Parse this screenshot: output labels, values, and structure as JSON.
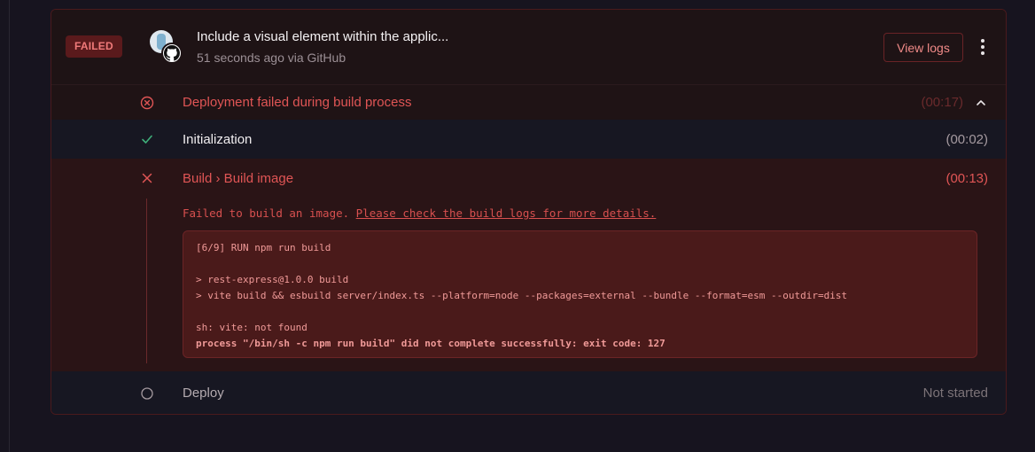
{
  "deployment": {
    "status_badge": "FAILED",
    "commit_title": "Include a visual element within the applic...",
    "commit_meta": "51 seconds ago via GitHub",
    "view_logs_label": "View logs"
  },
  "summary": {
    "label": "Deployment failed during build process",
    "duration": "(00:17)"
  },
  "steps": {
    "initialization": {
      "label": "Initialization",
      "duration": "(00:02)",
      "status": "success"
    },
    "build": {
      "label": "Build › Build image",
      "duration": "(00:13)",
      "status": "failed",
      "error_text": "Failed to build an image. ",
      "error_link": "Please check the build logs for more details.",
      "log_lines": [
        "[6/9] RUN npm run build",
        "",
        "> rest-express@1.0.0 build",
        "> vite build && esbuild server/index.ts --platform=node --packages=external --bundle --format=esm --outdir=dist",
        "",
        "sh: vite: not found",
        "process \"/bin/sh -c npm run build\" did not complete successfully: exit code: 127"
      ]
    },
    "deploy": {
      "label": "Deploy",
      "duration": "Not started",
      "status": "pending"
    }
  },
  "icons": {
    "summary": "x-circle-icon",
    "initialization": "check-icon",
    "build": "x-icon",
    "deploy": "circle-icon",
    "collapse": "chevron-up-icon",
    "menu": "kebab-menu-icon",
    "source": "github-icon"
  },
  "colors": {
    "error": "#e05555",
    "success": "#3fae7a",
    "background": "#17141f"
  }
}
